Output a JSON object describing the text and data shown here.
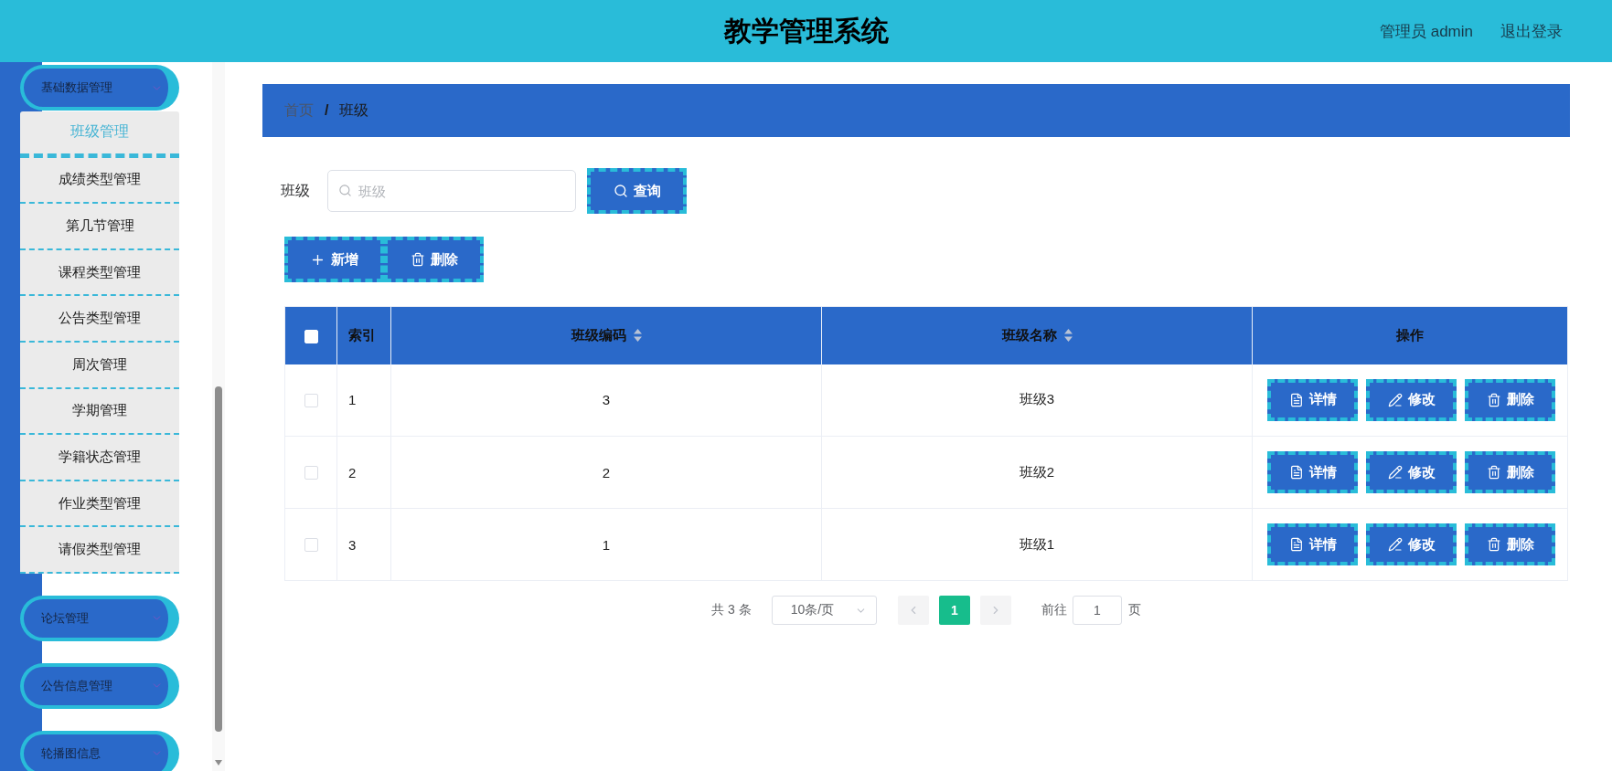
{
  "header": {
    "title": "教学管理系统",
    "user": "管理员 admin",
    "logout": "退出登录"
  },
  "sidebar": {
    "menus": [
      {
        "label": "基础数据管理",
        "expanded": true,
        "children": [
          {
            "label": "班级管理",
            "selected": true
          },
          {
            "label": "成绩类型管理",
            "selected": false
          },
          {
            "label": "第几节管理",
            "selected": false
          },
          {
            "label": "课程类型管理",
            "selected": false
          },
          {
            "label": "公告类型管理",
            "selected": false
          },
          {
            "label": "周次管理",
            "selected": false
          },
          {
            "label": "学期管理",
            "selected": false
          },
          {
            "label": "学籍状态管理",
            "selected": false
          },
          {
            "label": "作业类型管理",
            "selected": false
          },
          {
            "label": "请假类型管理",
            "selected": false
          }
        ]
      },
      {
        "label": "论坛管理",
        "expanded": false
      },
      {
        "label": "公告信息管理",
        "expanded": false
      },
      {
        "label": "轮播图信息",
        "expanded": false
      }
    ]
  },
  "breadcrumb": {
    "items": [
      {
        "label": "首页",
        "current": false
      },
      {
        "label": "班级",
        "current": true
      }
    ],
    "separator": "/"
  },
  "search": {
    "label": "班级",
    "placeholder": "班级",
    "button": "查询"
  },
  "toolbar": [
    {
      "kind": "add",
      "label": "新增"
    },
    {
      "kind": "delete",
      "label": "删除"
    }
  ],
  "table": {
    "header_checked": false,
    "columns": [
      {
        "label": "索引",
        "sortable": false
      },
      {
        "label": "班级编码",
        "sortable": true
      },
      {
        "label": "班级名称",
        "sortable": true
      },
      {
        "label": "操作",
        "sortable": false
      }
    ],
    "rows": [
      {
        "checked": false,
        "cells": [
          "1",
          "3",
          "班级3"
        ],
        "actions": [
          {
            "kind": "detail",
            "label": "详情"
          },
          {
            "kind": "edit",
            "label": "修改"
          },
          {
            "kind": "delete",
            "label": "删除"
          }
        ]
      },
      {
        "checked": false,
        "cells": [
          "2",
          "2",
          "班级2"
        ],
        "actions": [
          {
            "kind": "detail",
            "label": "详情"
          },
          {
            "kind": "edit",
            "label": "修改"
          },
          {
            "kind": "delete",
            "label": "删除"
          }
        ]
      },
      {
        "checked": false,
        "cells": [
          "3",
          "1",
          "班级1"
        ],
        "actions": [
          {
            "kind": "detail",
            "label": "详情"
          },
          {
            "kind": "edit",
            "label": "修改"
          },
          {
            "kind": "delete",
            "label": "删除"
          }
        ]
      }
    ]
  },
  "pagination": {
    "total": "共 3 条",
    "page_size": "10条/页",
    "prev_disabled": true,
    "pages": [
      {
        "label": "1",
        "selected": true
      }
    ],
    "next_disabled": true,
    "goto_label": "前往",
    "goto_value": "1",
    "goto_suffix": "页"
  }
}
